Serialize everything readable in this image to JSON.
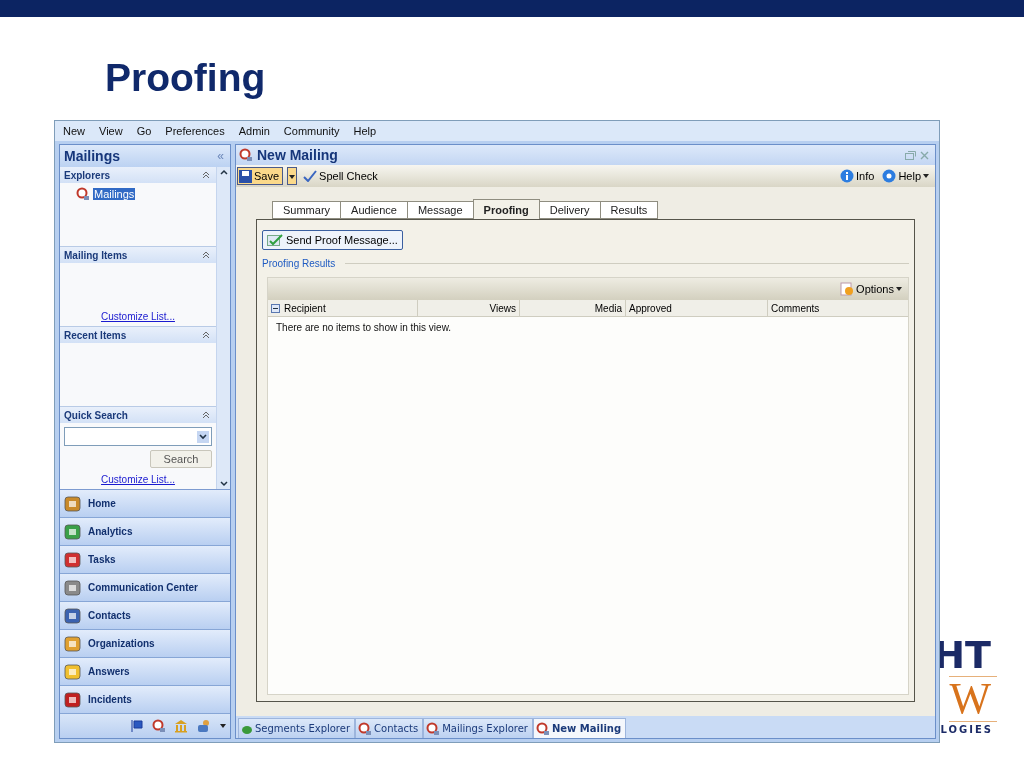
{
  "slide": {
    "title": "Proofing",
    "logo": [
      "HT",
      "W",
      "LOGIES"
    ]
  },
  "menu": [
    "New",
    "View",
    "Go",
    "Preferences",
    "Admin",
    "Community",
    "Help"
  ],
  "sidebar": {
    "title": "Mailings",
    "collapse": "«",
    "sections": [
      {
        "kind": "items",
        "title": "Explorers",
        "items": [
          {
            "label": "Mailings",
            "selected": true
          }
        ]
      },
      {
        "kind": "link",
        "title": "Mailing Items",
        "link": "Customize List..."
      },
      {
        "kind": "empty",
        "title": "Recent Items"
      },
      {
        "kind": "search",
        "title": "Quick Search",
        "button": "Search",
        "link": "Customize List..."
      }
    ],
    "nav": [
      "Home",
      "Analytics",
      "Tasks",
      "Communication Center",
      "Contacts",
      "Organizations",
      "Answers",
      "Incidents"
    ]
  },
  "document": {
    "title": "New Mailing",
    "toolbar": {
      "save": "Save",
      "spell": "Spell Check",
      "info": "Info",
      "help": "Help"
    },
    "tabs": [
      {
        "label": "Summary",
        "selected": false
      },
      {
        "label": "Audience",
        "selected": false
      },
      {
        "label": "Message",
        "selected": false
      },
      {
        "label": "Proofing",
        "selected": true
      },
      {
        "label": "Delivery",
        "selected": false
      },
      {
        "label": "Results",
        "selected": false
      }
    ],
    "send_button": "Send Proof Message...",
    "group_title": "Proofing Results",
    "options": "Options",
    "columns": [
      "Recipient",
      "Views",
      "Media",
      "Approved",
      "Comments"
    ],
    "empty": "There are no items to show in this view."
  },
  "taskbar": [
    {
      "label": "Segments Explorer",
      "selected": false
    },
    {
      "label": "Contacts",
      "selected": false
    },
    {
      "label": "Mailings Explorer",
      "selected": false
    },
    {
      "label": "New Mailing",
      "selected": true
    }
  ]
}
